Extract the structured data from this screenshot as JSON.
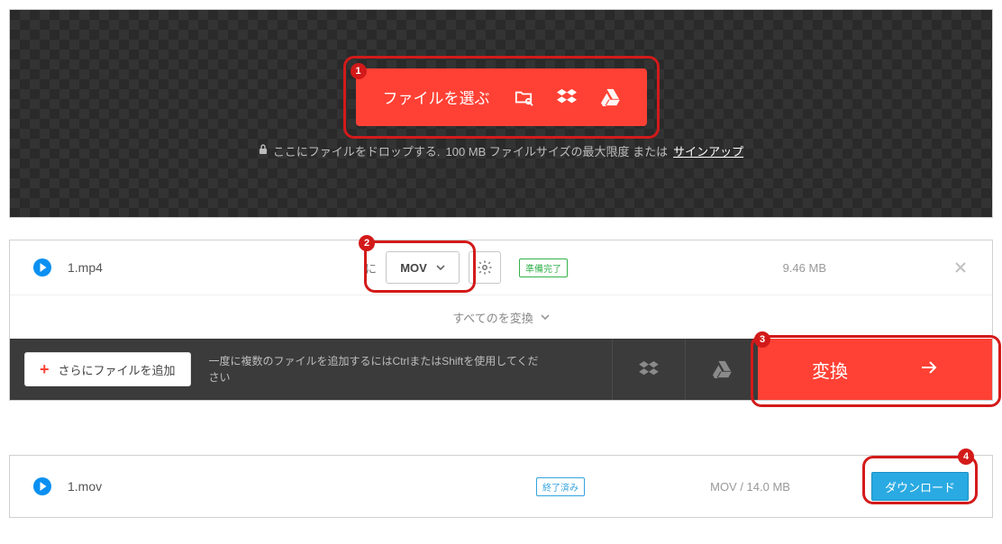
{
  "dropzone": {
    "choose_label": "ファイルを選ぶ",
    "hint_prefix": "ここにファイルをドロップする.",
    "hint_size": "100 MB ファイルサイズの最大限度 または",
    "hint_signup": "サインアップ"
  },
  "file_input": {
    "name": "1.mp4",
    "to_label": "に",
    "format": "MOV",
    "status": "準備完了",
    "size": "9.46 MB"
  },
  "convert_all_label": "すべてのを変換",
  "action": {
    "add_more": "さらにファイルを追加",
    "hint": "一度に複数のファイルを追加するにはCtrlまたはShiftを使用してください",
    "convert": "変換"
  },
  "result": {
    "name": "1.mov",
    "status": "終了済み",
    "info": "MOV / 14.0 MB",
    "download": "ダウンロード"
  },
  "steps": {
    "s1": "1",
    "s2": "2",
    "s3": "3",
    "s4": "4"
  }
}
